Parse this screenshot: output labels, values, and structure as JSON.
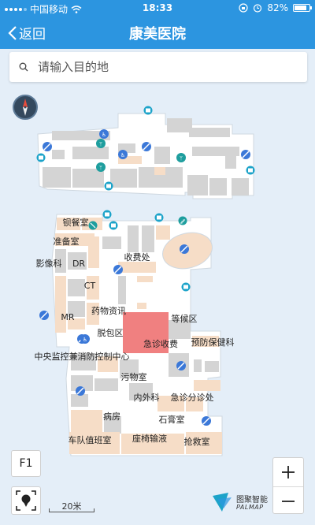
{
  "status_bar": {
    "carrier": "中国移动",
    "time": "18:33",
    "battery": "82%",
    "battery_level": 0.82
  },
  "nav": {
    "back_label": "返回",
    "title": "康美医院"
  },
  "search": {
    "placeholder": "请输入目的地"
  },
  "map": {
    "labels": [
      "钡餐室",
      "准备室",
      "影像科",
      "DR",
      "收费处",
      "CT",
      "MR",
      "药物资讯",
      "脱包区",
      "等候区",
      "急诊收费",
      "预防保健科",
      "中央监控兼消防控制中心",
      "污物室",
      "内外科",
      "急诊分诊处",
      "病房",
      "石膏室",
      "车队值班室",
      "座椅输液",
      "抢救室"
    ],
    "icon_names": [
      "compass-icon",
      "escalator-icon",
      "restroom-icon",
      "stairs-icon",
      "elevator-icon",
      "no-entry-icon"
    ]
  },
  "controls": {
    "floor": "F1",
    "scale": "20米",
    "zoom_in": "+",
    "zoom_out": "−"
  },
  "brand": {
    "name_cn": "图聚智能",
    "name_en": "PALMAP"
  },
  "colors": {
    "primary": "#2c95e0",
    "map_bg": "#e4eef8",
    "room_peach": "#f6ddc7",
    "room_gray": "#d4d4d4",
    "highlight_red": "#f08080"
  }
}
